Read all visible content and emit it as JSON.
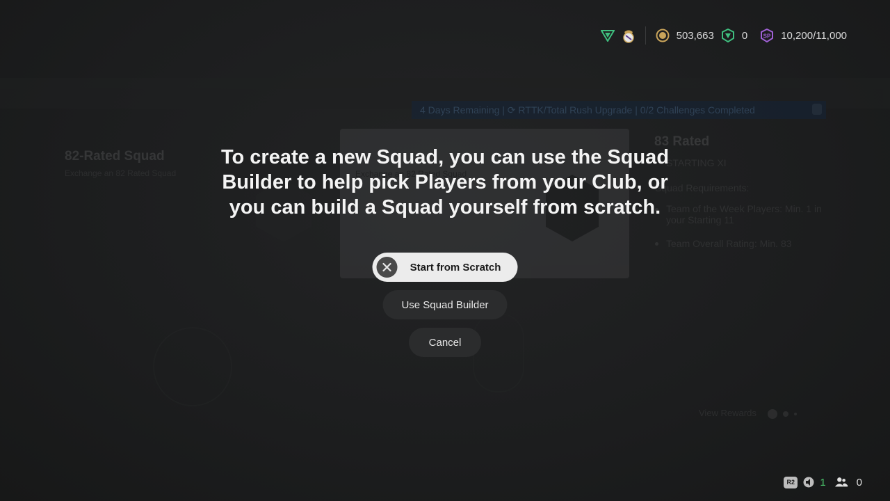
{
  "currency": {
    "coins": "503,663",
    "points": "0",
    "season_points": "10,200/11,000"
  },
  "background": {
    "tabs": [
      "",
      "",
      "",
      ""
    ],
    "subtab": "",
    "banner_text": "4 Days Remaining | ⟳ RTTK/Total Rush Upgrade | 0/2 Challenges Completed",
    "left_title": "82-Rated Squad",
    "left_subtitle": "Exchange an 82 Rated Squad",
    "card_subtitle": "Exchange an 82 Rated Squad",
    "right_title": "83 Rated",
    "right_subtitle": "STARTING XI",
    "requirements_label": "Squad Requirements:",
    "requirements": [
      "Team of the Week Players: Min. 1 in your Starting 11",
      "Team Overall Rating: Min. 83"
    ],
    "view_rewards": "View Rewards"
  },
  "dialog": {
    "message": "To create a new Squad, you can use the Squad Builder to help pick Players from your Club, or you can build a Squad yourself from scratch.",
    "start_from_scratch": "Start from Scratch",
    "use_squad_builder": "Use Squad Builder",
    "cancel": "Cancel"
  },
  "status": {
    "r2_label": "R2",
    "notifications": "1",
    "friends": "0"
  },
  "colors": {
    "accent_green": "#49c26a",
    "coin_gold": "#c9a45a",
    "sp_purple": "#a061d6",
    "points_green": "#3fbf7f"
  },
  "icons": {
    "club_badge": "club-crest-icon",
    "brand": "ea-fc-logo-icon",
    "coins": "coin-icon",
    "points": "fc-points-icon",
    "sp": "season-points-icon",
    "close": "close-icon",
    "speaker": "speaker-icon",
    "friends": "friends-icon"
  }
}
